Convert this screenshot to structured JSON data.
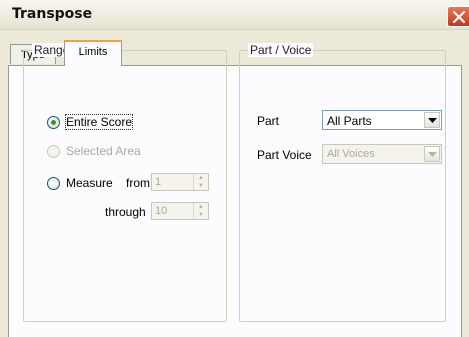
{
  "window": {
    "title": "Transpose"
  },
  "tabs": [
    {
      "label": "Type",
      "active": false
    },
    {
      "label": "Limits",
      "active": true
    }
  ],
  "range": {
    "legend": "Range",
    "entire_score": {
      "label": "Entire Score",
      "checked": true
    },
    "selected_area": {
      "label": "Selected Area",
      "enabled": false
    },
    "measure": {
      "label": "Measure",
      "checked": false
    },
    "from_label": "from",
    "from_value": "1",
    "through_label": "through",
    "through_value": "10"
  },
  "part_voice": {
    "legend": "Part / Voice",
    "part_label": "Part",
    "part_value": "All Parts",
    "part_voice_label": "Part Voice",
    "part_voice_value": "All Voices"
  },
  "icons": {
    "close": "close-icon",
    "dropdown": "chevron-down-icon"
  },
  "colors": {
    "close_button": "#d74d2e",
    "radio_checked": "#21a121",
    "active_tab_accent": "#f0a33b"
  }
}
